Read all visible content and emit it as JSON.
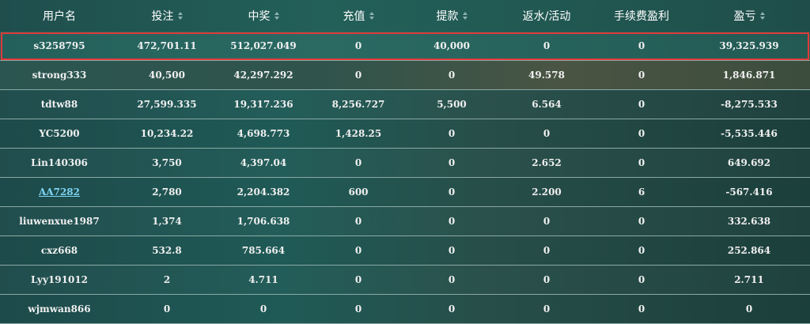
{
  "headers": [
    {
      "label": "用户名",
      "sortable": false
    },
    {
      "label": "投注",
      "sortable": true
    },
    {
      "label": "中奖",
      "sortable": true
    },
    {
      "label": "充值",
      "sortable": true
    },
    {
      "label": "提款",
      "sortable": true
    },
    {
      "label": "返水/活动",
      "sortable": false
    },
    {
      "label": "手续费盈利",
      "sortable": false
    },
    {
      "label": "盈亏",
      "sortable": true
    }
  ],
  "rows": [
    {
      "user": "s3258795",
      "bet": "472,701.11",
      "win": "512,027.049",
      "deposit": "0",
      "withdraw": "40,000",
      "rebate": "0",
      "fee": "0",
      "pnl": "39,325.939",
      "selected": true
    },
    {
      "user": "strong333",
      "bet": "40,500",
      "win": "42,297.292",
      "deposit": "0",
      "withdraw": "0",
      "rebate": "49.578",
      "fee": "0",
      "pnl": "1,846.871"
    },
    {
      "user": "tdtw88",
      "bet": "27,599.335",
      "win": "19,317.236",
      "deposit": "8,256.727",
      "withdraw": "5,500",
      "rebate": "6.564",
      "fee": "0",
      "pnl": "-8,275.533"
    },
    {
      "user": "YC5200",
      "bet": "10,234.22",
      "win": "4,698.773",
      "deposit": "1,428.25",
      "withdraw": "0",
      "rebate": "0",
      "fee": "0",
      "pnl": "-5,535.446"
    },
    {
      "user": "Lin140306",
      "bet": "3,750",
      "win": "4,397.04",
      "deposit": "0",
      "withdraw": "0",
      "rebate": "2.652",
      "fee": "0",
      "pnl": "649.692"
    },
    {
      "user": "AA7282",
      "bet": "2,780",
      "win": "2,204.382",
      "deposit": "600",
      "withdraw": "0",
      "rebate": "2.200",
      "fee": "6",
      "pnl": "-567.416",
      "link": true
    },
    {
      "user": "liuwenxue1987",
      "bet": "1,374",
      "win": "1,706.638",
      "deposit": "0",
      "withdraw": "0",
      "rebate": "0",
      "fee": "0",
      "pnl": "332.638"
    },
    {
      "user": "cxz668",
      "bet": "532.8",
      "win": "785.664",
      "deposit": "0",
      "withdraw": "0",
      "rebate": "0",
      "fee": "0",
      "pnl": "252.864"
    },
    {
      "user": "Lyy191012",
      "bet": "2",
      "win": "4.711",
      "deposit": "0",
      "withdraw": "0",
      "rebate": "0",
      "fee": "0",
      "pnl": "2.711"
    },
    {
      "user": "wjmwan866",
      "bet": "0",
      "win": "0",
      "deposit": "0",
      "withdraw": "0",
      "rebate": "0",
      "fee": "0",
      "pnl": "0"
    }
  ],
  "colors": {
    "selected_outline": "#e03a3a",
    "link": "#7fd4f3",
    "row_border": "#8aa9a6"
  }
}
